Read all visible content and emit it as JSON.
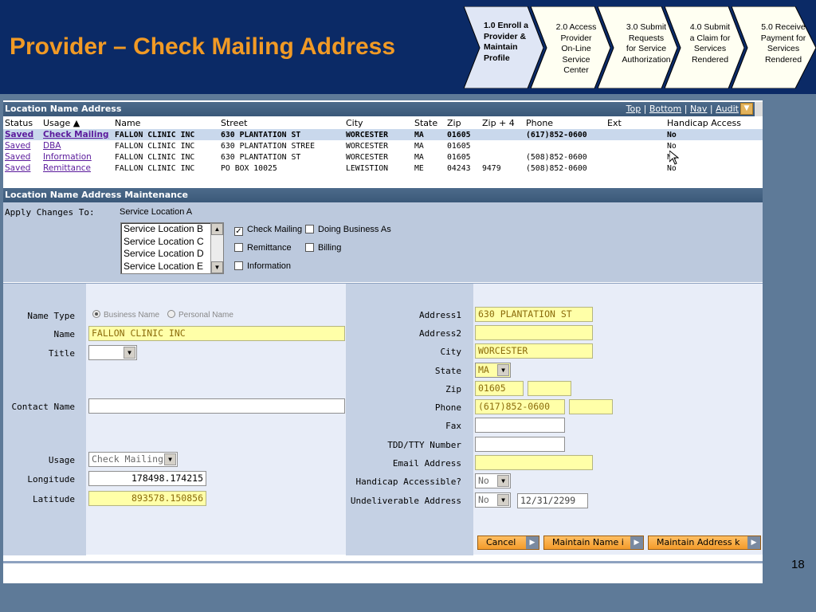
{
  "slide": {
    "title": "Provider – Check Mailing Address",
    "number": "18"
  },
  "steps": [
    {
      "label": "1.0 Enroll a\nProvider &\nMaintain\nProfile"
    },
    {
      "label": "2.0 Access\nProvider\nOn-Line\nService\nCenter"
    },
    {
      "label": "3.0 Submit\nRequests\nfor Service\nAuthorization"
    },
    {
      "label": "4.0 Submit\na Claim for\nServices\nRendered"
    },
    {
      "label": "5.0 Receive\nPayment for\nServices\nRendered"
    }
  ],
  "location_panel": {
    "title": "Location Name Address",
    "links": [
      "Top",
      "Bottom",
      "Nav",
      "Audit"
    ],
    "columns": [
      "Status",
      "Usage ▲",
      "Name",
      "Street",
      "City",
      "State",
      "Zip",
      "Zip + 4",
      "Phone",
      "Ext",
      "Handicap Access"
    ],
    "rows": [
      {
        "status": "Saved",
        "usage": "Check Mailing",
        "name": "FALLON CLINIC INC",
        "street": "630 PLANTATION ST",
        "city": "WORCESTER",
        "state": "MA",
        "zip": "01605",
        "zip4": "",
        "phone": "(617)852-0600",
        "ext": "",
        "handicap": "No"
      },
      {
        "status": "Saved",
        "usage": "DBA",
        "name": "FALLON CLINIC INC",
        "street": "630 PLANTATION STREE",
        "city": "WORCESTER",
        "state": "MA",
        "zip": "01605",
        "zip4": "",
        "phone": "",
        "ext": "",
        "handicap": "No"
      },
      {
        "status": "Saved",
        "usage": "Information",
        "name": "FALLON CLINIC INC",
        "street": "630 PLANTATION ST",
        "city": "WORCESTER",
        "state": "MA",
        "zip": "01605",
        "zip4": "",
        "phone": "(508)852-0600",
        "ext": "",
        "handicap": "No"
      },
      {
        "status": "Saved",
        "usage": "Remittance",
        "name": "FALLON CLINIC INC",
        "street": "PO BOX 10025",
        "city": "LEWISTION",
        "state": "ME",
        "zip": "04243",
        "zip4": "9479",
        "phone": "(508)852-0600",
        "ext": "",
        "handicap": "No"
      }
    ]
  },
  "maintenance": {
    "title": "Location Name Address Maintenance",
    "apply_label": "Apply Changes To:",
    "apply_value": "Service Location A",
    "locations": [
      "Service Location B",
      "Service Location C",
      "Service Location D",
      "Service Location E"
    ],
    "checks": {
      "check_mailing": "Check Mailing",
      "doing_business_as": "Doing Business As",
      "remittance": "Remittance",
      "billing": "Billing",
      "information": "Information"
    }
  },
  "form": {
    "labels": {
      "name_type": "Name Type",
      "name": "Name",
      "title": "Title",
      "contact_name": "Contact Name",
      "usage": "Usage",
      "longitude": "Longitude",
      "latitude": "Latitude",
      "address1": "Address1",
      "address2": "Address2",
      "city": "City",
      "state": "State",
      "zip": "Zip",
      "phone": "Phone",
      "fax": "Fax",
      "tdd": "TDD/TTY Number",
      "email": "Email Address",
      "handicap": "Handicap Accessible?",
      "undeliverable": "Undeliverable Address"
    },
    "name_type_options": [
      "Business Name",
      "Personal Name"
    ],
    "values": {
      "name": "FALLON CLINIC INC",
      "title": "",
      "contact_name": "",
      "usage": "Check Mailing",
      "longitude": "178498.174215",
      "latitude": "893578.150856",
      "address1": "630 PLANTATION ST",
      "address2": "",
      "city": "WORCESTER",
      "state": "MA",
      "zip": "01605",
      "zip4": "",
      "phone": "(617)852-0600",
      "phone_ext": "",
      "fax": "",
      "tdd": "",
      "email": "",
      "handicap": "No",
      "undeliverable": "No",
      "undeliverable_date": "12/31/2299"
    },
    "buttons": {
      "cancel": "Cancel",
      "maintain_name": "Maintain Name i",
      "maintain_address": "Maintain Address k"
    }
  }
}
